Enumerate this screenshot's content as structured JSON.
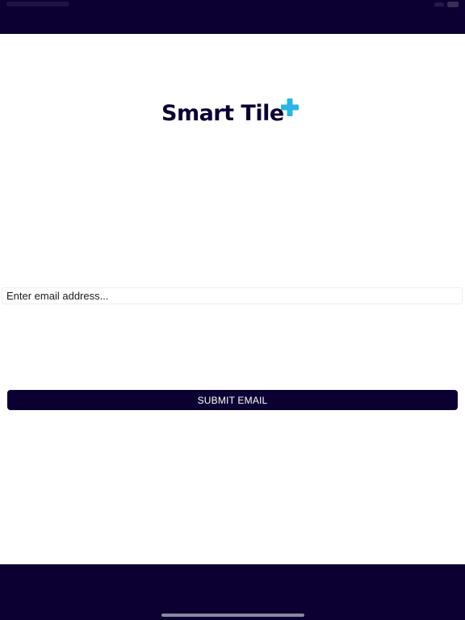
{
  "header": {
    "background_color": "#0c0033"
  },
  "logo": {
    "brand_name": "Smart Tile",
    "text_color": "#0c0033",
    "plus_icon_color": "#29b6e3"
  },
  "form": {
    "email_placeholder": "Enter email address...",
    "email_value": "",
    "submit_label": "SUBMIT EMAIL",
    "button_color": "#0c0033"
  },
  "footer": {
    "background_color": "#0c0033"
  }
}
